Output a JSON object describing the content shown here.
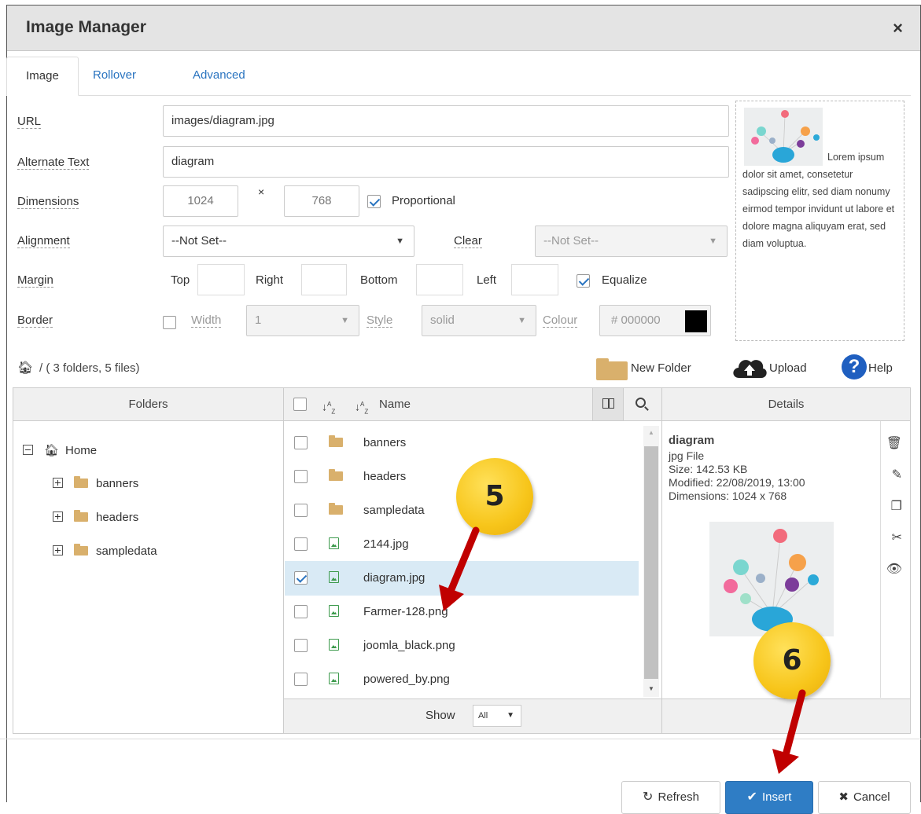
{
  "dialog": {
    "title": "Image Manager",
    "close": "×"
  },
  "tabs": [
    "Image",
    "Rollover",
    "Advanced"
  ],
  "form": {
    "url_label": "URL",
    "url_value": "images/diagram.jpg",
    "alt_label": "Alternate Text",
    "alt_value": "diagram",
    "dim_label": "Dimensions",
    "width": "1024",
    "times": "×",
    "height": "768",
    "proportional": "Proportional",
    "align_label": "Alignment",
    "align_value": "--Not Set--",
    "clear_label": "Clear",
    "clear_value": "--Not Set--",
    "margin_label": "Margin",
    "top": "Top",
    "right": "Right",
    "bottom": "Bottom",
    "left": "Left",
    "equalize": "Equalize",
    "border_label": "Border",
    "width_label": "Width",
    "border_width": "1",
    "style_label": "Style",
    "style_value": "solid",
    "colour_label": "Colour",
    "colour_value": "# 000000"
  },
  "preview": {
    "text": "Lorem ipsum dolor sit amet, consetetur sadipscing elitr, sed diam nonumy eirmod tempor invidunt ut labore et dolore magna aliquyam erat, sed diam voluptua."
  },
  "browser": {
    "path": "/ ( 3 folders, 5 files)",
    "new_folder": "New Folder",
    "upload": "Upload",
    "help": "Help",
    "folders_head": "Folders",
    "name_head": "Name",
    "details_head": "Details",
    "tree": {
      "home": "Home",
      "items": [
        "banners",
        "headers",
        "sampledata"
      ]
    },
    "files": [
      {
        "name": "banners",
        "type": "folder"
      },
      {
        "name": "headers",
        "type": "folder"
      },
      {
        "name": "sampledata",
        "type": "folder"
      },
      {
        "name": "2144.jpg",
        "type": "image"
      },
      {
        "name": "diagram.jpg",
        "type": "image"
      },
      {
        "name": "Farmer-128.png",
        "type": "image"
      },
      {
        "name": "joomla_black.png",
        "type": "image"
      },
      {
        "name": "powered_by.png",
        "type": "image"
      }
    ],
    "selected": "diagram.jpg",
    "show_label": "Show",
    "show_value": "All",
    "details": {
      "name": "diagram",
      "type": "jpg File",
      "size": "Size: 142.53 KB",
      "modified": "Modified: 22/08/2019, 13:00",
      "dimensions": "Dimensions: 1024 x 768"
    }
  },
  "buttons": {
    "refresh": "Refresh",
    "insert": "Insert",
    "cancel": "Cancel"
  },
  "badges": [
    "5",
    "6"
  ],
  "colors": {
    "accent": "#2f7dc5",
    "badge": "#f7c51a",
    "arrow": "#c00000"
  }
}
